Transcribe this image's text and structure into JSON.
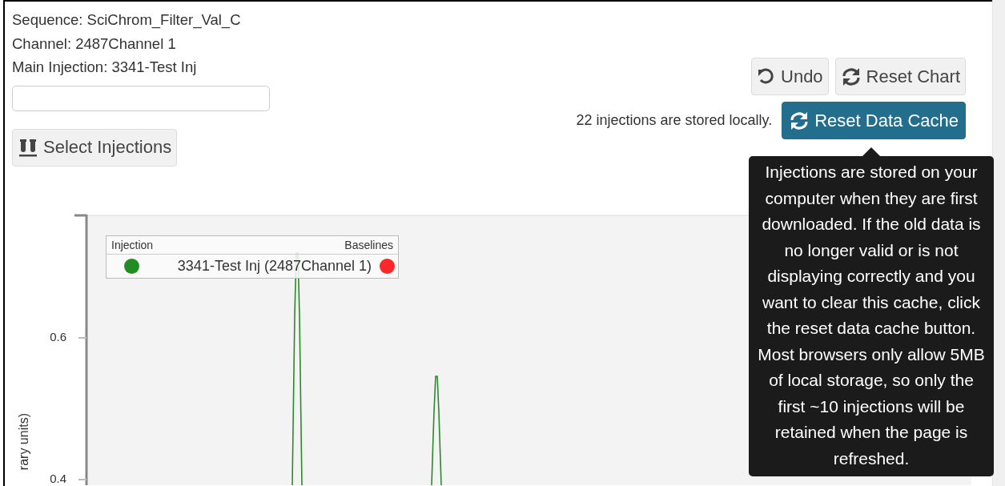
{
  "info": {
    "sequence": "Sequence: SciChrom_Filter_Val_C",
    "channel": "Channel: 2487Channel 1",
    "main_injection": "Main Injection: 3341-Test Inj"
  },
  "select_button": {
    "label": "Select Injections"
  },
  "toolbar": {
    "buttons": [
      {
        "label": "Undo",
        "kind": "undo"
      },
      {
        "label": "Reset Chart",
        "kind": "reset"
      }
    ]
  },
  "cache": {
    "status": "22 injections are stored locally.",
    "button": {
      "label": "Reset Data Cache"
    }
  },
  "tooltip": {
    "text": "Injections are stored on your computer when they are first downloaded. If the old data is no longer valid or is not displaying correctly and you want to clear this cache, click the reset data cache button. Most browsers only allow 5MB of local storage, so only the first ~10 injections will be retained when the page is refreshed."
  },
  "chart": {
    "y_axis_label": "rary units)",
    "y_ticks": [
      "0.6",
      "0.4"
    ],
    "legend": {
      "header_left": "Injection",
      "header_right": "Baselines",
      "entries": [
        {
          "label": "3341-Test Inj (2487Channel 1)",
          "color": "#228b22",
          "baseline": {
            "color": "#ff2828"
          }
        }
      ]
    }
  }
}
